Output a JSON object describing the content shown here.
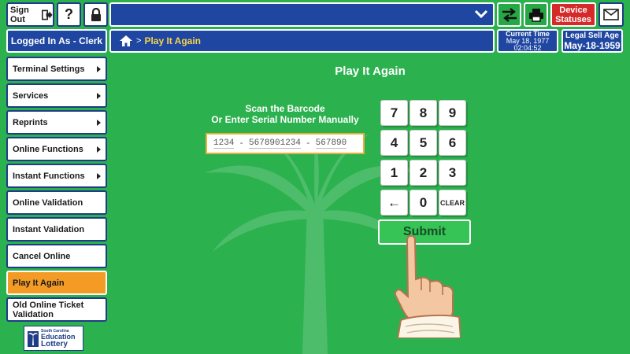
{
  "header": {
    "sign_out_label": "Sign Out",
    "help_label": "?",
    "device_statuses_label": "Device Statuses",
    "icons": [
      "sign-out-icon",
      "lock-icon",
      "chevron-down-icon",
      "swap-arrows-icon",
      "printer-icon",
      "envelope-icon"
    ]
  },
  "status": {
    "logged_in": "Logged In As - Clerk",
    "current_time_label": "Current Time",
    "current_date": "May 18, 1977",
    "current_time": "02:04:52",
    "legal_age_label": "Legal Sell Age",
    "legal_age_date": "May-18-1959"
  },
  "breadcrumb": {
    "separator": ">",
    "current": "Play It Again"
  },
  "sidebar": {
    "items": [
      {
        "label": "Terminal Settings",
        "arrow": true
      },
      {
        "label": "Services",
        "arrow": true
      },
      {
        "label": "Reprints",
        "arrow": true
      },
      {
        "label": "Online Functions",
        "arrow": true
      },
      {
        "label": "Instant Functions",
        "arrow": true
      },
      {
        "label": "Online Validation",
        "arrow": false
      },
      {
        "label": "Instant Validation",
        "arrow": false
      },
      {
        "label": "Cancel Online",
        "arrow": false
      },
      {
        "label": "Play It Again",
        "arrow": false,
        "active": true
      },
      {
        "label": "Old Online Ticket Validation",
        "arrow": false
      }
    ]
  },
  "main": {
    "title": "Play It Again",
    "scan_line1": "Scan the Barcode",
    "scan_line2": "Or Enter Serial Number Manually",
    "serial": {
      "part1": "1234",
      "part2": "5678901234",
      "part3": "567890",
      "separator": "-"
    },
    "keypad": [
      "7",
      "8",
      "9",
      "4",
      "5",
      "6",
      "1",
      "2",
      "3",
      "←",
      "0",
      "CLEAR"
    ],
    "submit_label": "Submit"
  },
  "logo": {
    "line1": "South Carolina",
    "line2": "Education",
    "line3": "Lottery"
  },
  "colors": {
    "background": "#2cb14f",
    "navy": "#1f47a1",
    "active_orange": "#f39b25",
    "alert_red": "#d52a2a",
    "breadcrumb_yellow": "#f7d44a"
  }
}
